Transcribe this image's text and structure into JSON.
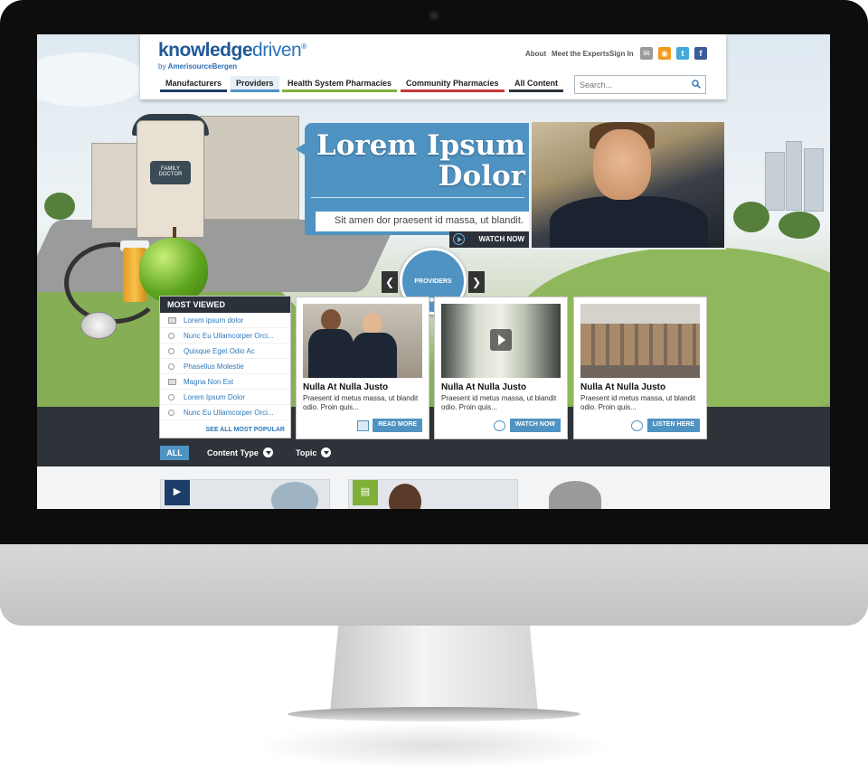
{
  "brand": {
    "logo_bold": "knowledge",
    "logo_light": "driven",
    "logo_mark": "®",
    "sub_prefix": "by ",
    "sub_company": "AmerisourceBergen"
  },
  "utility_nav": {
    "about": "About",
    "experts": "Meet the Experts",
    "signin": "Sign In"
  },
  "social": [
    {
      "name": "email-icon",
      "glyph": "✉",
      "color": "#9a9a9a"
    },
    {
      "name": "rss-icon",
      "glyph": "◉",
      "color": "#f39a1d"
    },
    {
      "name": "twitter-icon",
      "glyph": "t",
      "color": "#43a9dc"
    },
    {
      "name": "facebook-icon",
      "glyph": "f",
      "color": "#3b5b9a"
    }
  ],
  "nav": {
    "manufacturers": "Manufacturers",
    "providers": "Providers",
    "health_system": "Health System Pharmacies",
    "community": "Community Pharmacies",
    "all_content": "All Content",
    "accent_manufacturers": "#1d3c6a",
    "accent_providers": "#4f93c3",
    "accent_health": "#7fb03a",
    "accent_community": "#c8373a",
    "accent_all": "#2d3339"
  },
  "search": {
    "placeholder": "Search..."
  },
  "hero": {
    "title": "Lorem Ipsum Dolor",
    "subtitle": "Sit amen dor praesent id massa, ut blandit.",
    "cta": "WATCH NOW"
  },
  "carousel": {
    "label": "PROVIDERS",
    "prev": "❮",
    "next": "❯"
  },
  "sign": {
    "text": "FAMILY DOCTOR"
  },
  "most_viewed": {
    "title": "MOST VIEWED",
    "items": [
      {
        "label": "Lorem ipsum dolor",
        "icon": "document-icon"
      },
      {
        "label": "Nunc Eu Ullamcorper Orci...",
        "icon": "podcast-icon"
      },
      {
        "label": "Quisque Eget Odio Ac",
        "icon": "video-icon"
      },
      {
        "label": "Phasellus Molestie",
        "icon": "video-icon"
      },
      {
        "label": "Magna Non Est",
        "icon": "document-icon"
      },
      {
        "label": "Lorem Ipsum Dolor",
        "icon": "video-icon"
      },
      {
        "label": "Nunc Eu Ullamcorper Orci...",
        "icon": "podcast-icon"
      }
    ],
    "see_all": "SEE ALL MOST POPULAR"
  },
  "cards": [
    {
      "title": "Nulla At Nulla Justo",
      "desc": "Praesent id metus massa, ut blandit odio. Proin quis...",
      "cta": "READ MORE",
      "icon": "document-icon"
    },
    {
      "title": "Nulla At Nulla Justo",
      "desc": "Praesent id metus massa, ut blandit odio. Proin quis...",
      "cta": "WATCH NOW",
      "icon": "video-icon"
    },
    {
      "title": "Nulla At Nulla Justo",
      "desc": "Praesent id metus massa, ut blandit odio. Proin quis...",
      "cta": "LISTEN HERE",
      "icon": "podcast-icon"
    }
  ],
  "filters": {
    "all": "ALL",
    "content_type": "Content Type",
    "topic": "Topic"
  },
  "colors": {
    "brand_blue": "#4f93c3",
    "dark": "#2d3339",
    "link": "#2d78bb"
  }
}
